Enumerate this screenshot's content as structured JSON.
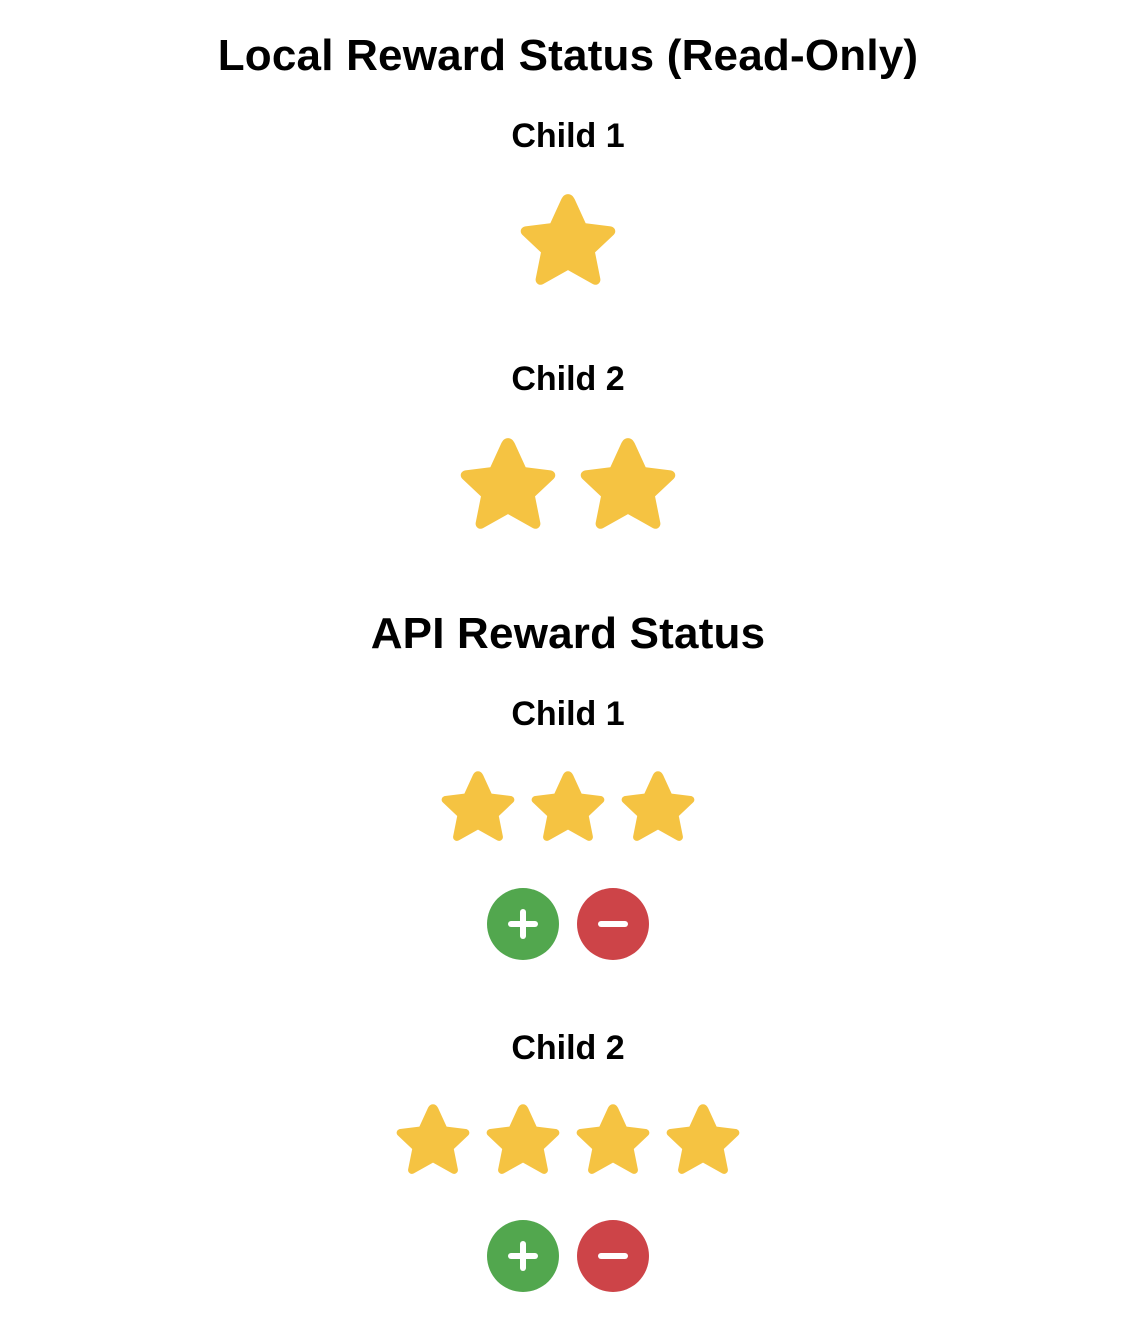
{
  "colors": {
    "star": "#F5C342",
    "add": "#52A74E",
    "remove": "#CD4448",
    "icon": "#ffffff"
  },
  "local": {
    "title": "Local Reward Status (Read-Only)",
    "children": [
      {
        "name": "Child 1",
        "stars": 1
      },
      {
        "name": "Child 2",
        "stars": 2
      }
    ]
  },
  "api": {
    "title": "API Reward Status",
    "children": [
      {
        "name": "Child 1",
        "stars": 3
      },
      {
        "name": "Child 2",
        "stars": 4
      }
    ]
  },
  "icons": {
    "star": "star-icon",
    "add": "plus-icon",
    "remove": "minus-icon"
  }
}
